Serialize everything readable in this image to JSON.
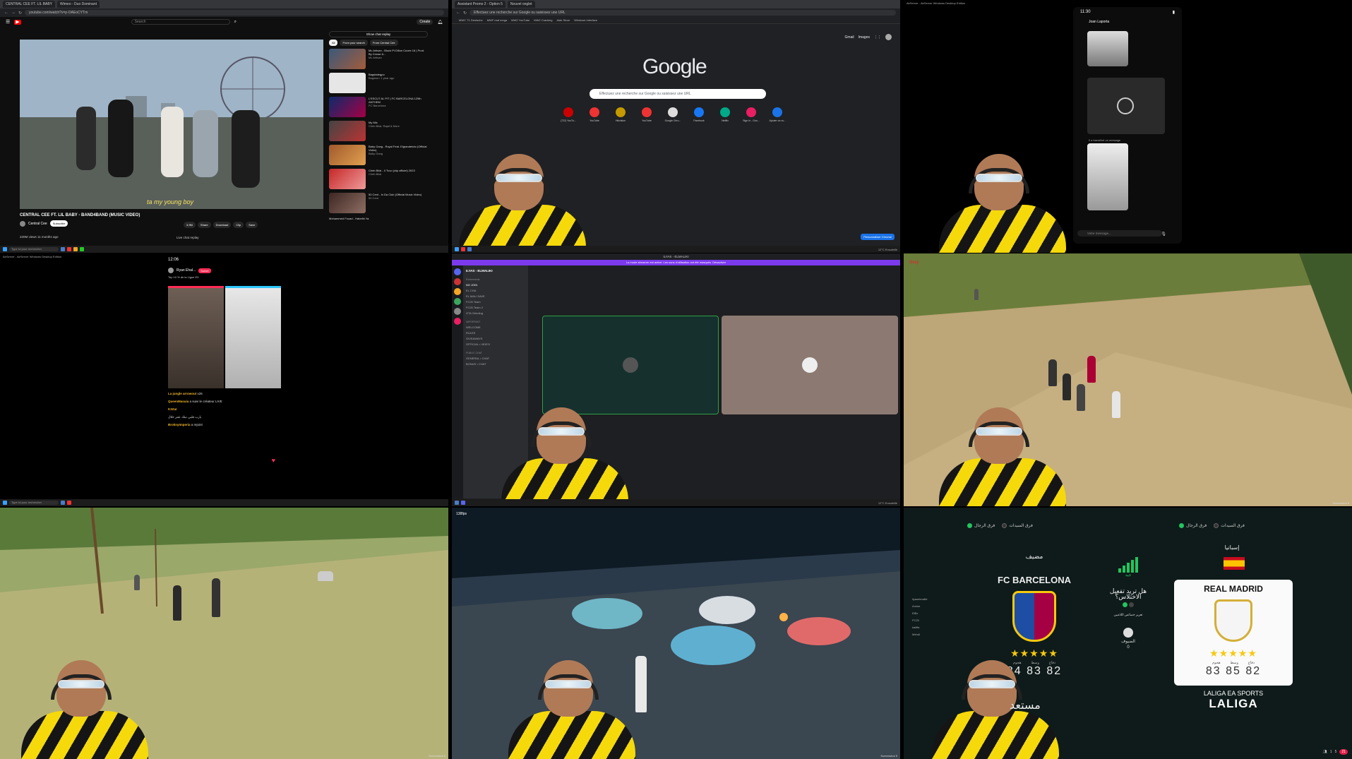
{
  "youtube": {
    "tabs": [
      "CENTRAL CEE FT. LIL BABY",
      "Wimeo - Duo Dominant"
    ],
    "url": "youtube.com/watch?v=p-OAEoCYTm",
    "search_placeholder": "Search",
    "create_label": "Create",
    "subtitle": "ta my young boy",
    "title": "CENTRAL CEE FT. LIL BABY - BAND4BAND (MUSIC VIDEO)",
    "channel": "Central Cee",
    "subscribe_label": "Subscribe",
    "actions": [
      "3.9M",
      "Share",
      "Download",
      "Clip",
      "Save"
    ],
    "views": "220M views  11 months ago",
    "show_chat_replay": "Show chat replay",
    "live_chat_replay": "Live chat replay",
    "chips": [
      "All",
      "From your search",
      "From Central Cee"
    ],
    "sidebar": [
      {
        "title": "Mc Artisan - Block Pt Dillon Cuvee 16 | Prod. By Crowe &...",
        "meta": "Mc Artisan"
      },
      {
        "title": "Bagdadegpo",
        "meta": "Bagdad • 1 year ago"
      },
      {
        "title": "L'ESCUT AL PIT | FC BARCELONA 125th ANTHEM",
        "meta": "FC Barcelona"
      },
      {
        "title": "My Mix",
        "meta": "Cheb Bilal, Rajaf & More"
      },
      {
        "title": "Baby Gang - Royal Feat. Elgrandetoto (Official Video)",
        "meta": "Baby Gang"
      },
      {
        "title": "Cheb Bilal - Il Tuvo (clip officiel) 2023",
        "meta": "Cheb Bilal"
      },
      {
        "title": "50 Cent - In Da Club (Official Music Video)",
        "meta": "50 Cent"
      },
      {
        "title": "Mohammed Fouad - Habeibi Ya",
        "meta": ""
      }
    ],
    "taskbar_search": "Type ici pour rechercher"
  },
  "google": {
    "tabs": [
      "Assistant Promo 2 - Option 5",
      "Nouvel onglet"
    ],
    "url": "Effectuez une recherche sur Google ou saisissez une URL",
    "bookmarks": [
      "MWC T1 Deutsche",
      "MWF real mega",
      "MW2 YouTube",
      "MW2 Cracking",
      "Aide Store",
      "Windows Interface"
    ],
    "logo": "Google",
    "links": [
      "Gmail",
      "Images"
    ],
    "search_placeholder": "Effectuez une recherche sur Google ou saisissez une URL",
    "shortcuts": [
      "(722) YouTu...",
      "YouTube",
      "Hikvision",
      "YouTube",
      "Google Chro...",
      "Facebook",
      "Netflix",
      "Sign In - Goo...",
      "Ajouter un ra..."
    ],
    "customize": "Personnaliser Chrome",
    "weather": "12°C  Ensoleillé"
  },
  "phone_chat": {
    "window_title": "AirServer - AirServer Windows Desktop Edition",
    "time": "11:30",
    "contact": "Joan Laporta",
    "input_placeholder": "Votre message...",
    "forwarded": "Il a transféré un message"
  },
  "tiktok": {
    "window_title": "AirServer - AirServer Windows Desktop Edition",
    "time": "12:06",
    "user": "Ryan Ehal...",
    "follow": "Suivre",
    "rank": "Top 10 % de la Ligue E3",
    "comments": [
      {
        "user": "La jungle arrowout",
        "text": "x26"
      },
      {
        "user": "QueenMasuia",
        "text": "a suivi le créateur LIVE"
      },
      {
        "user": "K3Zar",
        "text": ""
      },
      {
        "user": "",
        "text": "يارب قلبي نبتك عنتر حلال"
      },
      {
        "user": "BroknyImperia",
        "text": "a rejoint"
      }
    ],
    "taskbar_search": "Type ici pour rechercher"
  },
  "discord": {
    "window_title": "ILYAS - ELMALIKI",
    "banner": "La mode streamer est activé. Les sons d'utilisation ont été masqués.  Désactiver",
    "server": "ILYAS - ELMALIKI",
    "sections": [
      "Événements",
      "IMPORTANT",
      "PUBLIC CHAT"
    ],
    "channels": [
      "NO JOIN",
      "EL CHA",
      "EL MALI SAVE",
      "FC25 Team",
      "FC25 Team 2",
      "GTA Grinding",
      "WELCOME",
      "RULES",
      "GIVEAWAYS",
      "OFFICIAL • VIDEO",
      "GENERAL • CHAT",
      "BONUS • CHAT"
    ],
    "taskbar_weather": "12°C  Ensoleillé"
  },
  "gta1": {
    "hud": "Gray",
    "watermark": "Screenshot 5"
  },
  "gta2": {
    "watermark": "Screenshot 5"
  },
  "gta3": {
    "fps": "138fps",
    "watermark": "Screenshot 5"
  },
  "eafc": {
    "tabs_left": [
      "فرق الرجال",
      "فرق السيدات"
    ],
    "tabs_right": [
      "فرق الرجال",
      "فرق السيدات"
    ],
    "home_label": "مضيف",
    "home_team": "FC BARCELONA",
    "home_stars": "★★★★★",
    "home_labels": [
      "هجوم",
      "وسط",
      "دفاع"
    ],
    "home_ratings": "84 83 82",
    "away_label": "إسبانيا",
    "away_team": "REAL MADRID",
    "away_stars": "★★★★★",
    "away_labels": [
      "هجوم",
      "وسط",
      "دفاع"
    ],
    "away_ratings": "83 85 82",
    "league_line1": "LALIGA EA SPORTS",
    "league_line2": "LALIGA",
    "connection": "جيد",
    "question": "هل تريد تفعيل الاختلاس؟",
    "enhance": "تعزيز خصائص اللاعبين",
    "guest": "الضيوف",
    "guest_count": "0",
    "ready": "مستعد",
    "players": [
      "ilyaselmaliki",
      "Amine",
      "ElBx",
      "FC25",
      "kaliffa",
      "Mehdi"
    ],
    "status_count": "1",
    "status_friends": "5",
    "status_badge": "21",
    "colors": {
      "accent_green": "#22c55e",
      "star_gold": "#f6c90e",
      "fcb_blue": "#1d4ea3",
      "fcb_red": "#a50044"
    }
  }
}
